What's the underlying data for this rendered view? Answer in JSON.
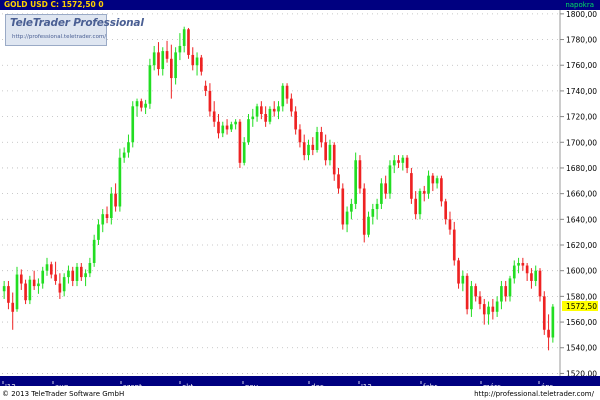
{
  "header": {
    "ticker_text": "GOLD USD C: 1572,50 0",
    "period_label": "napokra"
  },
  "logo": {
    "brand": "TeleTrader Professional",
    "url": "http://professional.teletrader.com/"
  },
  "footer": {
    "copyright": "© 2013 TeleTrader Software GmbH",
    "link": "http://professional.teletrader.com/"
  },
  "colors": {
    "up": "#22dd22",
    "down": "#ee2222",
    "bar_background": "#000080",
    "current_price_box": "#ffff00"
  },
  "chart_data": {
    "type": "candlestick",
    "ylim": [
      1518,
      1803
    ],
    "y_ticks": [
      "1520,00",
      "1540,00",
      "1560,00",
      "1580,00",
      "1600,00",
      "1620,00",
      "1640,00",
      "1660,00",
      "1680,00",
      "1700,00",
      "1720,00",
      "1740,00",
      "1760,00",
      "1780,00",
      "1800,00"
    ],
    "x_ticks": [
      "'12",
      "aug.",
      "szept",
      "okt.",
      "nov.",
      "dec.",
      "'13",
      "febr.",
      "márc",
      "ápr."
    ],
    "current_price": "1572,50",
    "series": [
      {
        "o": 1584,
        "h": 1592,
        "l": 1578,
        "c": 1588
      },
      {
        "o": 1588,
        "h": 1592,
        "l": 1570,
        "c": 1575
      },
      {
        "o": 1575,
        "h": 1583,
        "l": 1554,
        "c": 1568
      },
      {
        "o": 1570,
        "h": 1603,
        "l": 1568,
        "c": 1597
      },
      {
        "o": 1597,
        "h": 1601,
        "l": 1585,
        "c": 1590
      },
      {
        "o": 1590,
        "h": 1593,
        "l": 1574,
        "c": 1577
      },
      {
        "o": 1577,
        "h": 1596,
        "l": 1574,
        "c": 1593
      },
      {
        "o": 1593,
        "h": 1600,
        "l": 1585,
        "c": 1588
      },
      {
        "o": 1588,
        "h": 1594,
        "l": 1582,
        "c": 1590
      },
      {
        "o": 1590,
        "h": 1603,
        "l": 1586,
        "c": 1600
      },
      {
        "o": 1600,
        "h": 1610,
        "l": 1596,
        "c": 1605
      },
      {
        "o": 1605,
        "h": 1607,
        "l": 1594,
        "c": 1597
      },
      {
        "o": 1597,
        "h": 1607,
        "l": 1589,
        "c": 1592
      },
      {
        "o": 1590,
        "h": 1598,
        "l": 1578,
        "c": 1583
      },
      {
        "o": 1584,
        "h": 1598,
        "l": 1580,
        "c": 1595
      },
      {
        "o": 1595,
        "h": 1604,
        "l": 1590,
        "c": 1600
      },
      {
        "o": 1600,
        "h": 1603,
        "l": 1588,
        "c": 1592
      },
      {
        "o": 1592,
        "h": 1606,
        "l": 1588,
        "c": 1603
      },
      {
        "o": 1603,
        "h": 1606,
        "l": 1592,
        "c": 1595
      },
      {
        "o": 1595,
        "h": 1601,
        "l": 1588,
        "c": 1598
      },
      {
        "o": 1598,
        "h": 1610,
        "l": 1595,
        "c": 1606
      },
      {
        "o": 1606,
        "h": 1628,
        "l": 1603,
        "c": 1624
      },
      {
        "o": 1624,
        "h": 1640,
        "l": 1620,
        "c": 1636
      },
      {
        "o": 1636,
        "h": 1648,
        "l": 1630,
        "c": 1644
      },
      {
        "o": 1644,
        "h": 1650,
        "l": 1637,
        "c": 1641
      },
      {
        "o": 1641,
        "h": 1665,
        "l": 1636,
        "c": 1660
      },
      {
        "o": 1660,
        "h": 1668,
        "l": 1646,
        "c": 1650
      },
      {
        "o": 1650,
        "h": 1695,
        "l": 1646,
        "c": 1688
      },
      {
        "o": 1688,
        "h": 1696,
        "l": 1684,
        "c": 1692
      },
      {
        "o": 1692,
        "h": 1706,
        "l": 1688,
        "c": 1700
      },
      {
        "o": 1700,
        "h": 1732,
        "l": 1696,
        "c": 1728
      },
      {
        "o": 1728,
        "h": 1734,
        "l": 1720,
        "c": 1732
      },
      {
        "o": 1732,
        "h": 1734,
        "l": 1724,
        "c": 1727
      },
      {
        "o": 1727,
        "h": 1733,
        "l": 1722,
        "c": 1730
      },
      {
        "o": 1730,
        "h": 1765,
        "l": 1726,
        "c": 1760
      },
      {
        "o": 1760,
        "h": 1775,
        "l": 1756,
        "c": 1770
      },
      {
        "o": 1770,
        "h": 1778,
        "l": 1752,
        "c": 1757
      },
      {
        "o": 1757,
        "h": 1774,
        "l": 1752,
        "c": 1771
      },
      {
        "o": 1771,
        "h": 1779,
        "l": 1762,
        "c": 1765
      },
      {
        "o": 1765,
        "h": 1776,
        "l": 1734,
        "c": 1750
      },
      {
        "o": 1750,
        "h": 1774,
        "l": 1745,
        "c": 1770
      },
      {
        "o": 1770,
        "h": 1785,
        "l": 1764,
        "c": 1775
      },
      {
        "o": 1775,
        "h": 1790,
        "l": 1770,
        "c": 1788
      },
      {
        "o": 1788,
        "h": 1789,
        "l": 1765,
        "c": 1768
      },
      {
        "o": 1768,
        "h": 1774,
        "l": 1756,
        "c": 1760
      },
      {
        "o": 1760,
        "h": 1770,
        "l": 1752,
        "c": 1766
      },
      {
        "o": 1766,
        "h": 1768,
        "l": 1752,
        "c": 1755
      },
      {
        "o": 1744,
        "h": 1748,
        "l": 1736,
        "c": 1740
      },
      {
        "o": 1740,
        "h": 1746,
        "l": 1720,
        "c": 1724
      },
      {
        "o": 1724,
        "h": 1732,
        "l": 1712,
        "c": 1716
      },
      {
        "o": 1716,
        "h": 1722,
        "l": 1703,
        "c": 1707
      },
      {
        "o": 1707,
        "h": 1716,
        "l": 1704,
        "c": 1713
      },
      {
        "o": 1713,
        "h": 1718,
        "l": 1706,
        "c": 1710
      },
      {
        "o": 1710,
        "h": 1716,
        "l": 1708,
        "c": 1714
      },
      {
        "o": 1714,
        "h": 1718,
        "l": 1710,
        "c": 1716
      },
      {
        "o": 1716,
        "h": 1718,
        "l": 1680,
        "c": 1684
      },
      {
        "o": 1684,
        "h": 1704,
        "l": 1682,
        "c": 1700
      },
      {
        "o": 1700,
        "h": 1722,
        "l": 1698,
        "c": 1718
      },
      {
        "o": 1718,
        "h": 1726,
        "l": 1712,
        "c": 1720
      },
      {
        "o": 1720,
        "h": 1730,
        "l": 1716,
        "c": 1728
      },
      {
        "o": 1728,
        "h": 1732,
        "l": 1718,
        "c": 1722
      },
      {
        "o": 1722,
        "h": 1728,
        "l": 1712,
        "c": 1716
      },
      {
        "o": 1716,
        "h": 1728,
        "l": 1714,
        "c": 1726
      },
      {
        "o": 1726,
        "h": 1732,
        "l": 1720,
        "c": 1724
      },
      {
        "o": 1724,
        "h": 1732,
        "l": 1718,
        "c": 1728
      },
      {
        "o": 1728,
        "h": 1746,
        "l": 1724,
        "c": 1744
      },
      {
        "o": 1744,
        "h": 1746,
        "l": 1730,
        "c": 1734
      },
      {
        "o": 1734,
        "h": 1738,
        "l": 1720,
        "c": 1724
      },
      {
        "o": 1724,
        "h": 1728,
        "l": 1706,
        "c": 1710
      },
      {
        "o": 1710,
        "h": 1714,
        "l": 1696,
        "c": 1700
      },
      {
        "o": 1700,
        "h": 1706,
        "l": 1686,
        "c": 1690
      },
      {
        "o": 1690,
        "h": 1702,
        "l": 1686,
        "c": 1698
      },
      {
        "o": 1698,
        "h": 1704,
        "l": 1690,
        "c": 1694
      },
      {
        "o": 1694,
        "h": 1712,
        "l": 1692,
        "c": 1708
      },
      {
        "o": 1708,
        "h": 1712,
        "l": 1696,
        "c": 1700
      },
      {
        "o": 1700,
        "h": 1706,
        "l": 1682,
        "c": 1686
      },
      {
        "o": 1686,
        "h": 1702,
        "l": 1682,
        "c": 1698
      },
      {
        "o": 1698,
        "h": 1700,
        "l": 1670,
        "c": 1675
      },
      {
        "o": 1675,
        "h": 1680,
        "l": 1660,
        "c": 1664
      },
      {
        "o": 1664,
        "h": 1668,
        "l": 1632,
        "c": 1636
      },
      {
        "o": 1636,
        "h": 1650,
        "l": 1630,
        "c": 1646
      },
      {
        "o": 1646,
        "h": 1656,
        "l": 1640,
        "c": 1652
      },
      {
        "o": 1652,
        "h": 1692,
        "l": 1648,
        "c": 1686
      },
      {
        "o": 1686,
        "h": 1690,
        "l": 1660,
        "c": 1664
      },
      {
        "o": 1664,
        "h": 1668,
        "l": 1622,
        "c": 1628
      },
      {
        "o": 1628,
        "h": 1646,
        "l": 1626,
        "c": 1642
      },
      {
        "o": 1642,
        "h": 1652,
        "l": 1636,
        "c": 1648
      },
      {
        "o": 1648,
        "h": 1656,
        "l": 1640,
        "c": 1652
      },
      {
        "o": 1652,
        "h": 1672,
        "l": 1648,
        "c": 1668
      },
      {
        "o": 1668,
        "h": 1674,
        "l": 1656,
        "c": 1660
      },
      {
        "o": 1660,
        "h": 1686,
        "l": 1656,
        "c": 1682
      },
      {
        "o": 1682,
        "h": 1690,
        "l": 1676,
        "c": 1686
      },
      {
        "o": 1686,
        "h": 1690,
        "l": 1680,
        "c": 1684
      },
      {
        "o": 1684,
        "h": 1690,
        "l": 1678,
        "c": 1688
      },
      {
        "o": 1688,
        "h": 1690,
        "l": 1676,
        "c": 1680
      },
      {
        "o": 1676,
        "h": 1680,
        "l": 1652,
        "c": 1656
      },
      {
        "o": 1656,
        "h": 1662,
        "l": 1640,
        "c": 1644
      },
      {
        "o": 1644,
        "h": 1664,
        "l": 1640,
        "c": 1662
      },
      {
        "o": 1662,
        "h": 1666,
        "l": 1654,
        "c": 1660
      },
      {
        "o": 1660,
        "h": 1678,
        "l": 1656,
        "c": 1674
      },
      {
        "o": 1674,
        "h": 1676,
        "l": 1662,
        "c": 1668
      },
      {
        "o": 1668,
        "h": 1674,
        "l": 1664,
        "c": 1672
      },
      {
        "o": 1672,
        "h": 1674,
        "l": 1650,
        "c": 1654
      },
      {
        "o": 1654,
        "h": 1656,
        "l": 1636,
        "c": 1640
      },
      {
        "o": 1640,
        "h": 1646,
        "l": 1628,
        "c": 1632
      },
      {
        "o": 1632,
        "h": 1638,
        "l": 1604,
        "c": 1608
      },
      {
        "o": 1608,
        "h": 1610,
        "l": 1586,
        "c": 1590
      },
      {
        "o": 1590,
        "h": 1600,
        "l": 1584,
        "c": 1596
      },
      {
        "o": 1596,
        "h": 1598,
        "l": 1566,
        "c": 1570
      },
      {
        "o": 1570,
        "h": 1592,
        "l": 1564,
        "c": 1588
      },
      {
        "o": 1588,
        "h": 1590,
        "l": 1576,
        "c": 1580
      },
      {
        "o": 1580,
        "h": 1584,
        "l": 1570,
        "c": 1574
      },
      {
        "o": 1574,
        "h": 1578,
        "l": 1558,
        "c": 1566
      },
      {
        "o": 1566,
        "h": 1576,
        "l": 1558,
        "c": 1572
      },
      {
        "o": 1572,
        "h": 1578,
        "l": 1562,
        "c": 1568
      },
      {
        "o": 1568,
        "h": 1580,
        "l": 1564,
        "c": 1576
      },
      {
        "o": 1576,
        "h": 1592,
        "l": 1570,
        "c": 1588
      },
      {
        "o": 1588,
        "h": 1592,
        "l": 1576,
        "c": 1580
      },
      {
        "o": 1580,
        "h": 1596,
        "l": 1576,
        "c": 1594
      },
      {
        "o": 1594,
        "h": 1608,
        "l": 1590,
        "c": 1604
      },
      {
        "o": 1604,
        "h": 1610,
        "l": 1598,
        "c": 1606
      },
      {
        "o": 1606,
        "h": 1610,
        "l": 1600,
        "c": 1604
      },
      {
        "o": 1604,
        "h": 1606,
        "l": 1592,
        "c": 1598
      },
      {
        "o": 1598,
        "h": 1602,
        "l": 1586,
        "c": 1592
      },
      {
        "o": 1592,
        "h": 1604,
        "l": 1588,
        "c": 1600
      },
      {
        "o": 1600,
        "h": 1602,
        "l": 1576,
        "c": 1580
      },
      {
        "o": 1580,
        "h": 1584,
        "l": 1550,
        "c": 1554
      },
      {
        "o": 1554,
        "h": 1566,
        "l": 1538,
        "c": 1548
      },
      {
        "o": 1548,
        "h": 1574,
        "l": 1544,
        "c": 1572
      }
    ]
  }
}
